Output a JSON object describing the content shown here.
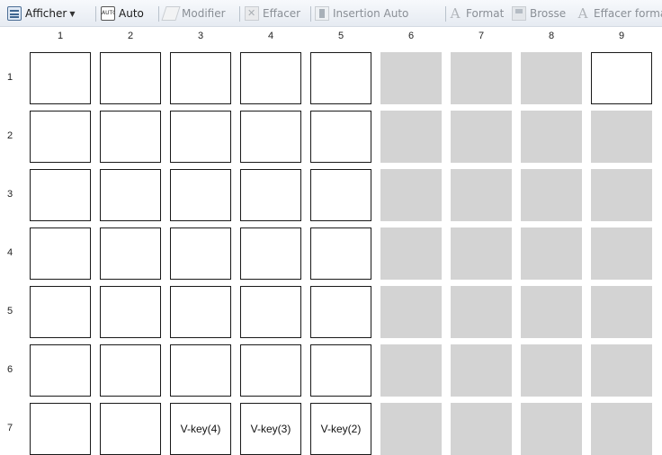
{
  "toolbar": {
    "items": [
      {
        "label": "Afficher",
        "icon": "afficher-icon",
        "dropdown": true,
        "enabled": true
      },
      {
        "label": "Auto",
        "icon": "auto-icon",
        "icon_text": "AUTO",
        "enabled": true
      },
      {
        "label": "Modifier",
        "icon": "modifier-icon",
        "enabled": false
      },
      {
        "label": "Effacer",
        "icon": "effacer-icon",
        "enabled": false
      },
      {
        "label": "Insertion Auto",
        "icon": "insertion-auto-icon",
        "enabled": false
      },
      {
        "label": "Format",
        "icon": "format-icon",
        "icon_text": "A",
        "enabled": false
      },
      {
        "label": "Brosse",
        "icon": "brosse-icon",
        "enabled": false
      },
      {
        "label": "Effacer format",
        "icon": "effacer-format-icon",
        "icon_text": "A",
        "enabled": false
      }
    ]
  },
  "grid": {
    "columns": [
      "1",
      "2",
      "3",
      "4",
      "5",
      "6",
      "7",
      "8",
      "9"
    ],
    "rows": [
      "1",
      "2",
      "3",
      "4",
      "5",
      "6",
      "7"
    ],
    "enabled_columns": 5,
    "extra_enabled": [
      {
        "row": 0,
        "col": 8
      }
    ],
    "cell_labels": [
      {
        "row": 6,
        "col": 2,
        "text": "V-key(4)"
      },
      {
        "row": 6,
        "col": 3,
        "text": "V-key(3)"
      },
      {
        "row": 6,
        "col": 4,
        "text": "V-key(2)"
      }
    ]
  },
  "colors": {
    "cell_enabled": "#ffffff",
    "cell_disabled": "#d3d3d3",
    "cell_border": "#1a1a1a"
  }
}
